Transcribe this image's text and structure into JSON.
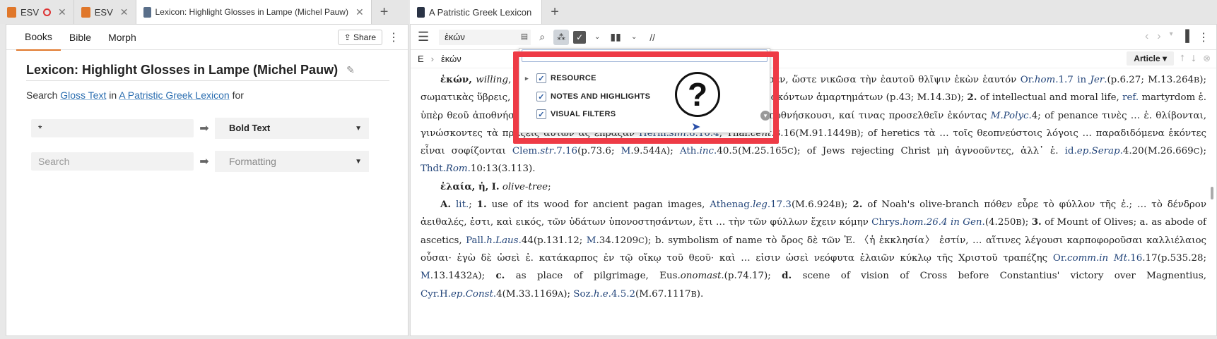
{
  "left_tabs": [
    {
      "label": "ESV",
      "color": "#e0772a",
      "recording": true
    },
    {
      "label": "ESV",
      "color": "#e0772a",
      "recording": false
    },
    {
      "label": "Lexicon: Highlight Glosses in Lampe (Michel Pauw)",
      "color": "#5a6f8a",
      "recording": false
    }
  ],
  "right_tabs": [
    {
      "label": "A Patristic Greek Lexicon",
      "color": "#2a3345"
    }
  ],
  "left": {
    "toolbar_tabs": [
      "Books",
      "Bible",
      "Morph"
    ],
    "share_label": "Share",
    "title": "Lexicon: Highlight Glosses in Lampe (Michel Pauw)",
    "search_prefix": "Search",
    "search_field": "Gloss Text",
    "search_in": "in",
    "search_resource": "A Patristic Greek Lexicon",
    "search_for": "for",
    "rows": [
      {
        "input": "*",
        "format": "Bold Text",
        "placeholder": false
      },
      {
        "input": "Search",
        "format": "Formatting",
        "placeholder": true
      }
    ]
  },
  "right": {
    "reference": "ἑκών",
    "breadcrumb_letter": "E",
    "breadcrumb_word": "ἑκών",
    "article_label": "Article",
    "popup": {
      "items": [
        "RESOURCE",
        "NOTES AND HIGHLIGHTS",
        "VISUAL FILTERS"
      ]
    }
  },
  "accent_color": "#e0772a",
  "highlight_frame_color": "#ee3b46"
}
